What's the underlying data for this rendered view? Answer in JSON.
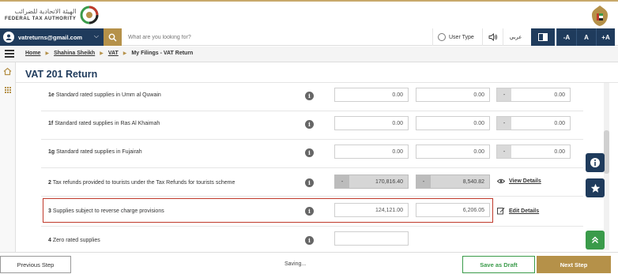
{
  "header": {
    "logo_arabic": "الهيئة الاتحادية للضرائب",
    "logo_english": "FEDERAL TAX AUTHORITY"
  },
  "topbar": {
    "email": "vatreturns@gmail.com",
    "search_placeholder": "What are you looking for?",
    "user_type_label": "User Type",
    "arabic_label": "عربي",
    "font_small": "-A",
    "font_normal": "A",
    "font_large": "+A"
  },
  "breadcrumb": {
    "home": "Home",
    "user": "Shahina Sheikh",
    "vat": "VAT",
    "current": "My Filings - VAT Return"
  },
  "page": {
    "title": "VAT 201 Return"
  },
  "rows": [
    {
      "num": "1e",
      "label": "Standard rated supplies in Umm al Quwain",
      "amount": "0.00",
      "vat": "0.00",
      "adj": "0.00",
      "adj_prefix": "-"
    },
    {
      "num": "1f",
      "label": "Standard rated supplies in Ras Al Khaimah",
      "amount": "0.00",
      "vat": "0.00",
      "adj": "0.00",
      "adj_prefix": "-"
    },
    {
      "num": "1g",
      "label": "Standard rated supplies in Fujairah",
      "amount": "0.00",
      "vat": "0.00",
      "adj": "0.00",
      "adj_prefix": "-"
    },
    {
      "num": "2",
      "label": "Tax refunds provided to tourists under the Tax Refunds for tourists scheme",
      "amount": "170,816.40",
      "vat": "8,540.82",
      "amount_prefix": "-",
      "vat_prefix": "-",
      "action": "View Details"
    },
    {
      "num": "3",
      "label": "Supplies subject to reverse charge provisions",
      "amount": "124,121.00",
      "vat": "6,206.05",
      "action": "Edit Details"
    },
    {
      "num": "4",
      "label": "Zero rated supplies",
      "amount": ""
    }
  ],
  "footer": {
    "previous": "Previous Step",
    "saving": "Saving...",
    "draft": "Save as Draft",
    "next": "Next Step"
  },
  "colors": {
    "navy": "#1f3b5c",
    "gold": "#b59149",
    "green": "#3a9b4a",
    "highlight": "#c0392b"
  }
}
